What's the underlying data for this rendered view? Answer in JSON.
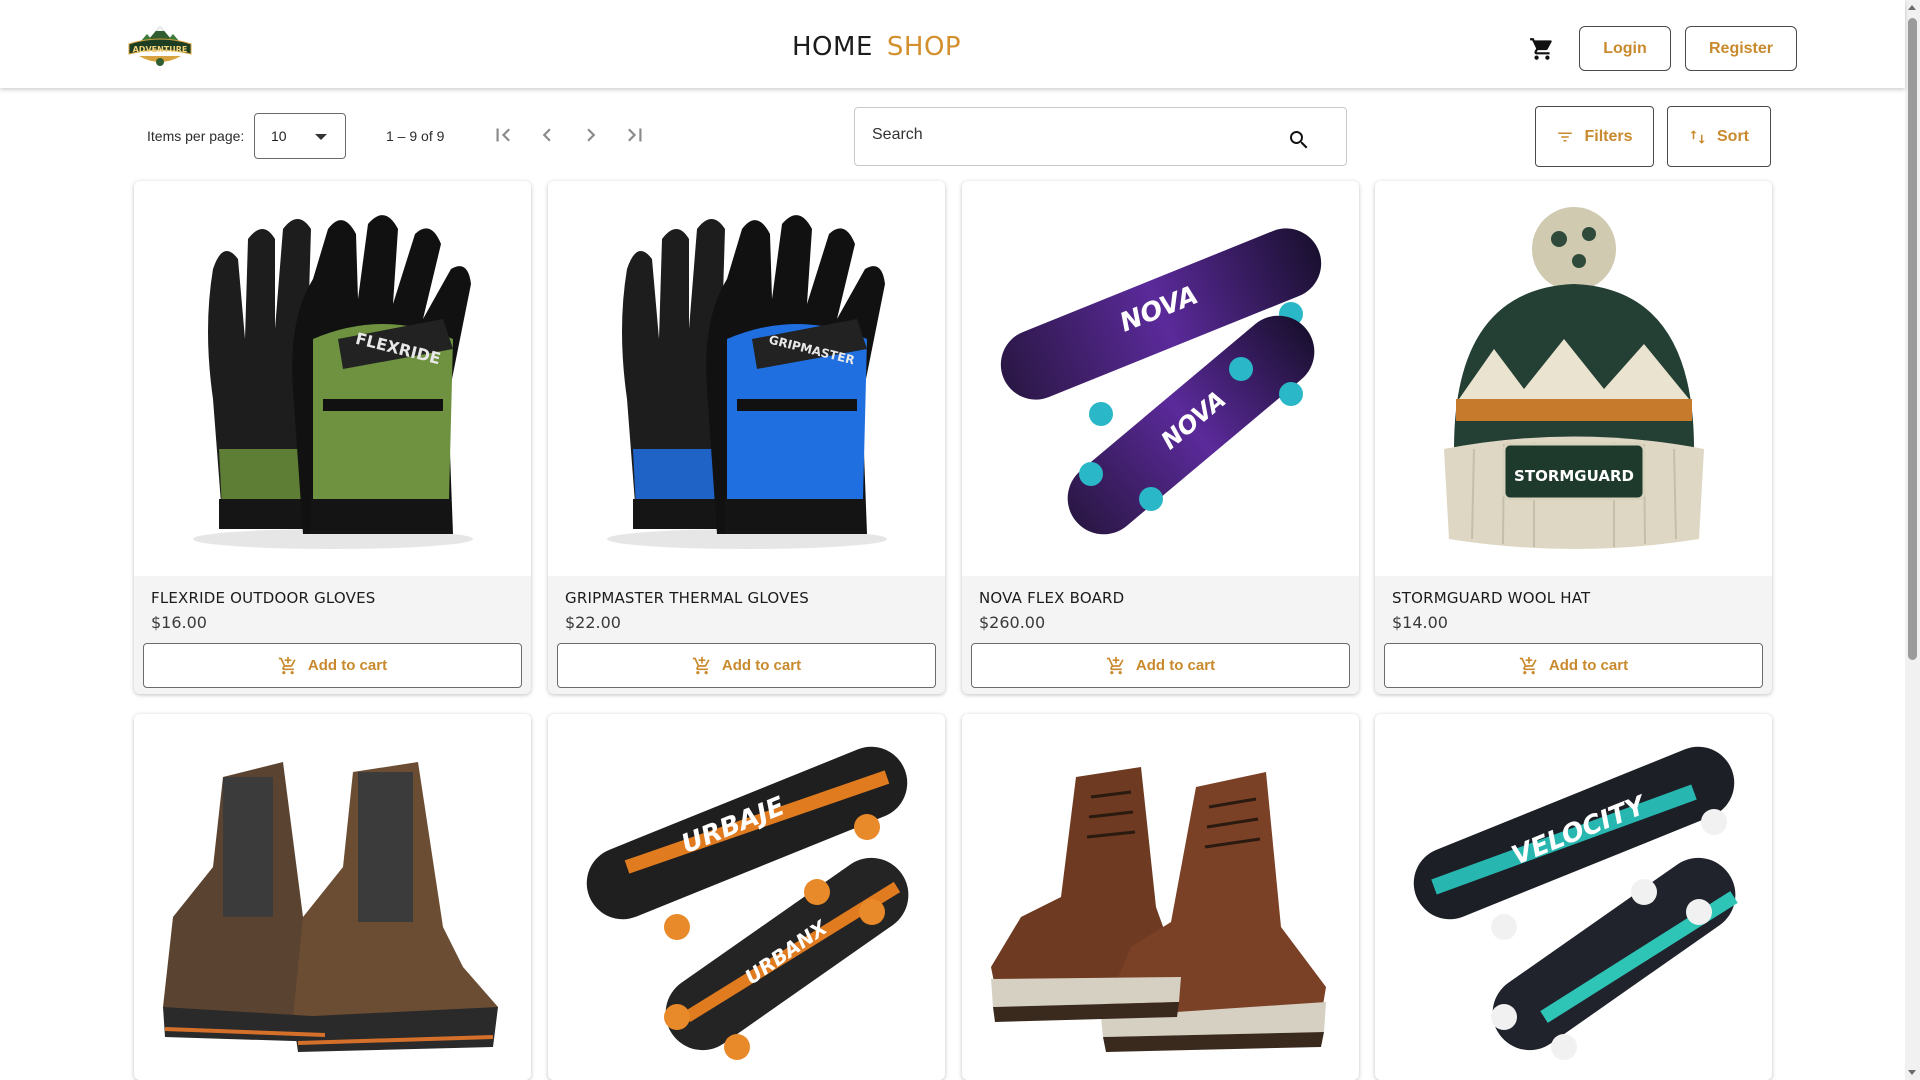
{
  "header": {
    "logo_text": "ADVENTURE",
    "nav": [
      {
        "label": "HOME"
      },
      {
        "label": "SHOP"
      }
    ],
    "login_label": "Login",
    "register_label": "Register",
    "accent_color": "#d4902e"
  },
  "toolbar": {
    "items_per_page_label": "Items per page:",
    "items_per_page_value": "10",
    "range_label": "1 – 9 of 9",
    "search_placeholder": "Search",
    "filters_label": "Filters",
    "sort_label": "Sort"
  },
  "products": [
    {
      "name": "FLEXRIDE OUTDOOR GLOVES",
      "price": "$16.00",
      "add_label": "Add to cart",
      "image": "green-gloves"
    },
    {
      "name": "GRIPMASTER THERMAL GLOVES",
      "price": "$22.00",
      "add_label": "Add to cart",
      "image": "blue-gloves"
    },
    {
      "name": "NOVA FLEX BOARD",
      "price": "$260.00",
      "add_label": "Add to cart",
      "image": "purple-skateboard"
    },
    {
      "name": "STORMGUARD WOOL HAT",
      "price": "$14.00",
      "add_label": "Add to cart",
      "image": "wool-beanie"
    },
    {
      "image": "hiking-boots"
    },
    {
      "image": "orange-skateboard"
    },
    {
      "image": "leather-boots"
    },
    {
      "image": "teal-skateboard"
    }
  ]
}
